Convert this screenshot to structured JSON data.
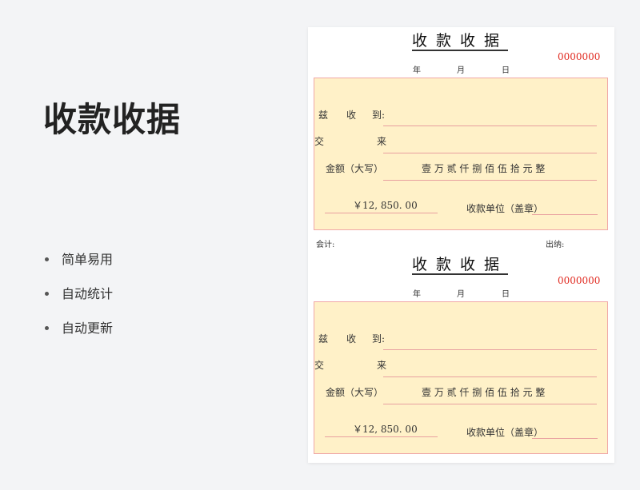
{
  "page": {
    "title": "收款收据"
  },
  "features": [
    "简单易用",
    "自动统计",
    "自动更新"
  ],
  "receipts": [
    {
      "title": "收款收据",
      "number": "0000000",
      "date": {
        "year": "年",
        "month": "月",
        "day": "日"
      },
      "fields": {
        "received_from_1": "兹",
        "received_from_2": "收",
        "received_from_3": "到:",
        "payment_1": "交",
        "payment_2": "来",
        "amount_label": "金额（大写）",
        "amount_words": "壹 万 贰 仟 捌 佰 伍 拾 元 整",
        "amount_figure": "￥12, 850. 00",
        "payee_label": "收款单位（盖章）"
      },
      "footer": {
        "accountant": "会计:",
        "cashier": "出纳:"
      }
    },
    {
      "title": "收款收据",
      "number": "0000000",
      "date": {
        "year": "年",
        "month": "月",
        "day": "日"
      },
      "fields": {
        "received_from_1": "兹",
        "received_from_2": "收",
        "received_from_3": "到:",
        "payment_1": "交",
        "payment_2": "来",
        "amount_label": "金额（大写）",
        "amount_words": "壹 万 贰 仟 捌 佰 伍 拾 元 整",
        "amount_figure": "￥12, 850. 00",
        "payee_label": "收款单位（盖章）"
      }
    }
  ]
}
